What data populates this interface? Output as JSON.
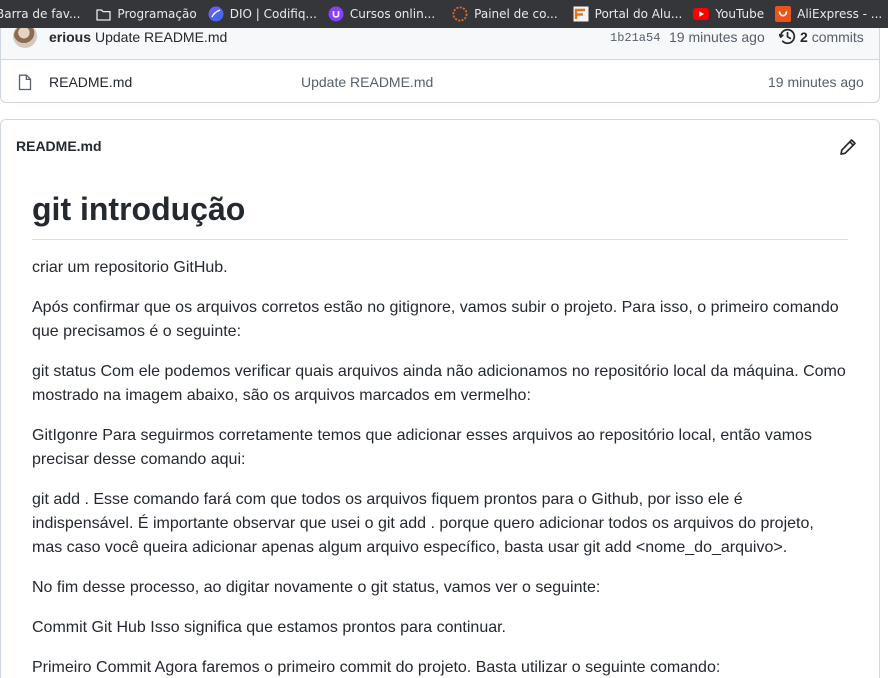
{
  "bookmarks": [
    {
      "icon": "folder-icon",
      "label": "Barra de fav..."
    },
    {
      "icon": "folder-icon",
      "label": "Programação"
    },
    {
      "icon": "dio-icon",
      "label": "DIO | Codifiq..."
    },
    {
      "icon": "cursos-icon",
      "label": "Cursos onlin..."
    },
    {
      "icon": "painel-icon",
      "label": "Painel de co..."
    },
    {
      "icon": "portal-icon",
      "label": "Portal do Alu..."
    },
    {
      "icon": "youtube-icon",
      "label": "YouTube"
    },
    {
      "icon": "aliexpress-icon",
      "label": "AliExpress - ..."
    }
  ],
  "commit": {
    "author": "erious",
    "message": "Update README.md",
    "sha": "1b21a54",
    "time": "19 minutes ago",
    "count": "2",
    "count_label": "commits"
  },
  "files": [
    {
      "name": "README.md",
      "message": "Update README.md",
      "time": "19 minutes ago"
    }
  ],
  "readme": {
    "header": "README.md",
    "title": "git introdução",
    "paragraphs": [
      "criar um repositorio GitHub.",
      "Após confirmar que os arquivos corretos estão no gitignore, vamos subir o projeto. Para isso, o primeiro comando que precisamos é o seguinte:",
      "git status Com ele podemos verificar quais arquivos ainda não adicionamos no repositório local da máquina. Como mostrado na imagem abaixo, são os arquivos marcados em vermelho:",
      "GitIgonre Para seguirmos corretamente temos que adicionar esses arquivos ao repositório local, então vamos precisar desse comando aqui:",
      "git add . Esse comando fará com que todos os arquivos fiquem prontos para o Github, por isso ele é indispensável. É importante observar que usei o git add . porque quero adicionar todos os arquivos do projeto, mas caso você queira adicionar apenas algum arquivo específico, basta usar git add <nome_do_arquivo>.",
      "No fim desse processo, ao digitar novamente o git status, vamos ver o seguinte:",
      "Commit Git Hub Isso significa que estamos prontos para continuar.",
      "Primeiro Commit Agora faremos o primeiro commit do projeto. Basta utilizar o seguinte comando:"
    ]
  },
  "colors": {
    "bookmark_bar": "#35363a",
    "text": "#24292f",
    "muted": "#57606a",
    "border": "#d0d7de"
  }
}
